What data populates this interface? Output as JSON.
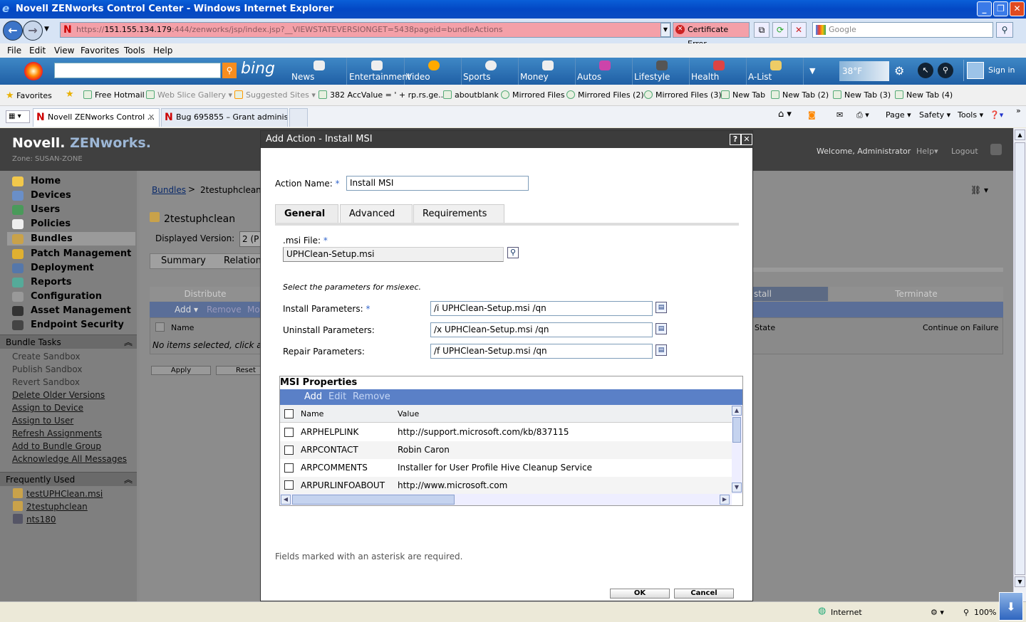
{
  "window": {
    "title": "Novell ZENworks Control Center - Windows Internet Explorer"
  },
  "address": {
    "url_host": "151.155.134.179",
    "url_rest": ":444/zenworks/jsp/index.jsp?__VIEWSTATEVERSIONGET=5438pageid=bundleActions",
    "url_scheme": "https://",
    "cert_label": "Certificate Error",
    "search_placeholder": "Google"
  },
  "menu": [
    "File",
    "Edit",
    "View",
    "Favorites",
    "Tools",
    "Help"
  ],
  "bing": {
    "logo": "bing",
    "temp": "38°F",
    "signin": "Sign in",
    "items": [
      "News",
      "Entertainment",
      "Video",
      "Sports",
      "Money",
      "Autos",
      "Lifestyle",
      "Health",
      "A-List"
    ]
  },
  "favorites": {
    "label": "Favorites",
    "items": [
      "Free Hotmail",
      "Web Slice Gallery ▾",
      "Suggested Sites ▾",
      "382 AccValue = ' + rp.rs.ge...",
      "aboutblank",
      "Mirrored Files",
      "Mirrored Files (2)",
      "Mirrored Files (3)",
      "New Tab",
      "New Tab (2)",
      "New Tab (3)",
      "New Tab (4)"
    ]
  },
  "tabs": [
    {
      "label": "Novell ZENworks Control ..."
    },
    {
      "label": "Bug 695855 – Grant administ..."
    }
  ],
  "commands": [
    "Page ▾",
    "Safety ▾",
    "Tools ▾"
  ],
  "zen": {
    "logo_a": "Novell.",
    "logo_b": "ZENworks.",
    "zone": "Zone: SUSAN-ZONE",
    "welcome": "Welcome, Administrator",
    "help": "Help▾",
    "logout": "Logout",
    "nav": [
      "Home",
      "Devices",
      "Users",
      "Policies",
      "Bundles",
      "Patch Management",
      "Deployment",
      "Reports",
      "Configuration",
      "Asset Management",
      "Endpoint Security"
    ],
    "bundle_tasks_title": "Bundle Tasks",
    "bundle_tasks": [
      "Create Sandbox",
      "Publish Sandbox",
      "Revert Sandbox",
      "Delete Older Versions",
      "Assign to Device",
      "Assign to User",
      "Refresh Assignments",
      "Add to Bundle Group",
      "Acknowledge All Messages"
    ],
    "frequent_title": "Frequently Used",
    "frequent": [
      "testUPHClean.msi",
      "2testuphclean",
      "nts180"
    ],
    "breadcrumb_root": "Bundles",
    "breadcrumb_current": "2testuphclean",
    "bundle_name": "2testuphclean",
    "displayed_version_label": "Displayed Version:",
    "displayed_version_value": "2 (P",
    "subtabs": [
      "Summary",
      "Relation"
    ],
    "phase_distribute": "Distribute",
    "phase_install": "stall",
    "phase_terminate": "Terminate",
    "add_label": "Add ▾",
    "remove_label": "Remove",
    "more_label": "Mo",
    "col_name": "Name",
    "col_state": "State",
    "col_continue": "Continue on Failure",
    "empty_msg": "No items selected, click a",
    "apply": "Apply",
    "reset": "Reset"
  },
  "modal": {
    "title": "Add Action - Install MSI",
    "action_name_label": "Action Name:",
    "action_name_value": "Install MSI",
    "tabs": [
      "General",
      "Advanced",
      "Requirements"
    ],
    "msi_file_label": ".msi File:",
    "msi_file_value": "UPHClean-Setup.msi",
    "params_hint": "Select the parameters for msiexec.",
    "install_label": "Install Parameters:",
    "install_value": "/i UPHClean-Setup.msi /qn",
    "uninstall_label": "Uninstall Parameters:",
    "uninstall_value": "/x UPHClean-Setup.msi /qn",
    "repair_label": "Repair Parameters:",
    "repair_value": "/f UPHClean-Setup.msi /qn",
    "props_title": "MSI Properties",
    "props_actions": [
      "Add",
      "Edit",
      "Remove"
    ],
    "col_name": "Name",
    "col_value": "Value",
    "props": [
      {
        "name": "ARPHELPLINK",
        "value": "http://support.microsoft.com/kb/837115"
      },
      {
        "name": "ARPCONTACT",
        "value": "Robin Caron"
      },
      {
        "name": "ARPCOMMENTS",
        "value": "Installer for User Profile Hive Cleanup Service"
      },
      {
        "name": "ARPURLINFOABOUT",
        "value": "http://www.microsoft.com"
      }
    ],
    "required_note": "Fields marked with an asterisk are required.",
    "ok": "OK",
    "cancel": "Cancel"
  },
  "status": {
    "zone": "Internet",
    "zoom": "100%"
  }
}
